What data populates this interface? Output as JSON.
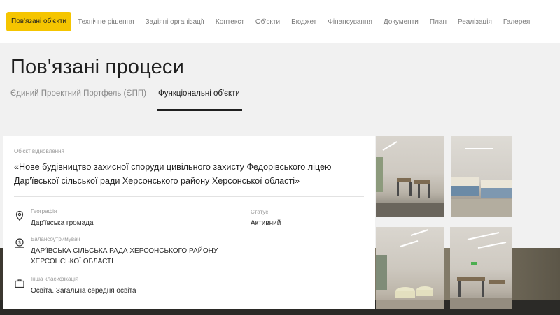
{
  "nav": {
    "items": [
      {
        "label": "Пов'язані об'єкти",
        "active": true
      },
      {
        "label": "Технічне рішення",
        "active": false
      },
      {
        "label": "Задіяні організації",
        "active": false
      },
      {
        "label": "Контекст",
        "active": false
      },
      {
        "label": "Об'єкти",
        "active": false
      },
      {
        "label": "Бюджет",
        "active": false
      },
      {
        "label": "Фінансування",
        "active": false
      },
      {
        "label": "Документи",
        "active": false
      },
      {
        "label": "План",
        "active": false
      },
      {
        "label": "Реалізація",
        "active": false
      },
      {
        "label": "Галерея",
        "active": false
      }
    ],
    "accent_color": "#f5c500"
  },
  "page": {
    "title": "Пов'язані процеси"
  },
  "tabs": [
    {
      "label": "Єдиний Проектний Портфель (ЄПП)",
      "active": false
    },
    {
      "label": "Функціональні об'єкти",
      "active": true
    }
  ],
  "card": {
    "kicker": "Об'єкт відновлення",
    "title": "«Нове будівництво захисної споруди цивільного захисту Федорівського ліцею Дар'ївської сільської ради Херсонського району Херсонської області»",
    "geography": {
      "label": "Географія",
      "value": "Дар'ївська громада",
      "icon": "location-pin-icon"
    },
    "status": {
      "label": "Статус",
      "value": "Активний"
    },
    "holder": {
      "label": "Балансоутримувач",
      "value": "ДАР'ЇВСЬКА СІЛЬСЬКА РАДА ХЕРСОНСЬКОГО РАЙОНУ ХЕРСОНСЬКОЇ ОБЛАСТІ",
      "icon": "money-bag-icon"
    },
    "classification": {
      "label": "Інша класифікація",
      "value": "Освіта. Загальна середня освіта",
      "icon": "briefcase-icon"
    }
  },
  "gallery": {
    "photos": [
      {
        "caption": "photo-shelter-room-chairs"
      },
      {
        "caption": "photo-shelter-room-beds"
      },
      {
        "caption": "photo-shelter-room-seats"
      },
      {
        "caption": "photo-shelter-room-table"
      }
    ]
  }
}
